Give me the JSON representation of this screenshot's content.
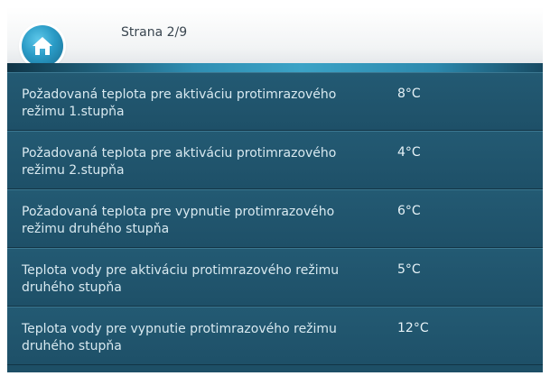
{
  "header": {
    "page_label": "Strana 2/9",
    "home_icon": "home-icon"
  },
  "settings": [
    {
      "label": "Požadovaná teplota pre aktiváciu protimrazového režimu 1.stupňa",
      "value": "8°C"
    },
    {
      "label": "Požadovaná teplota pre aktiváciu protimrazového režimu 2.stupňa",
      "value": "4°C"
    },
    {
      "label": "Požadovaná teplota pre vypnutie protimrazového režimu druhého stupňa",
      "value": "6°C"
    },
    {
      "label": "Teplota vody pre aktiváciu protimrazového režimu druhého stupňa",
      "value": "5°C"
    },
    {
      "label": "Teplota vody pre vypnutie protimrazového režimu druhého stupňa",
      "value": "12°C"
    }
  ],
  "colors": {
    "panel": "#1d4f66",
    "accent": "#2f8fb3"
  }
}
